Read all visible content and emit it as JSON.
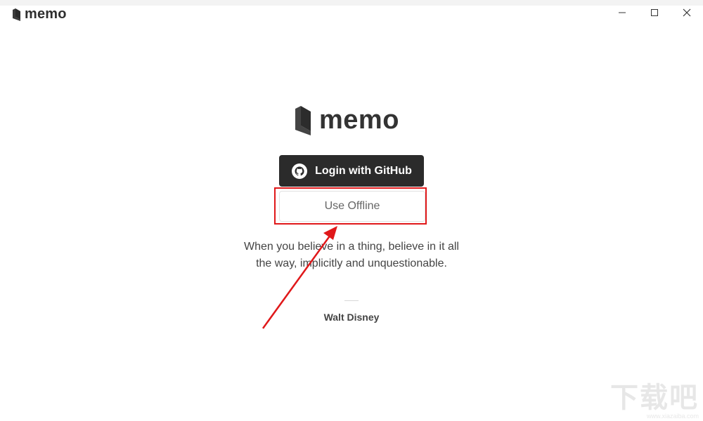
{
  "app": {
    "title": "memo"
  },
  "window_controls": {
    "minimize_icon": "minimize-icon",
    "maximize_icon": "maximize-icon",
    "close_icon": "close-icon"
  },
  "brand": {
    "name": "memo"
  },
  "login": {
    "github_label": "Login with GitHub",
    "offline_label": "Use Offline"
  },
  "quote": {
    "text": "When you believe in a thing, believe in it all the way, implicitly and unquestionable.",
    "author": "Walt Disney"
  },
  "watermark": {
    "text": "下载吧",
    "sub": "www.xiazaiba.com"
  },
  "colors": {
    "accent": "#2b2b2b",
    "annotation": "#e0181a"
  }
}
